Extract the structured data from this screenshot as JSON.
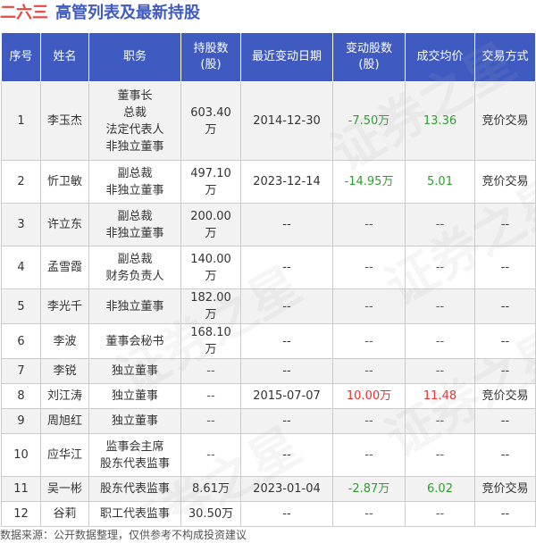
{
  "title": {
    "stock_name": "二六三",
    "rest": "高管列表及最新持股"
  },
  "columns": [
    "序号",
    "姓名",
    "职务",
    "持股数\n(股)",
    "最近变动日期",
    "变动股数\n(股)",
    "成交均价",
    "交易方式"
  ],
  "rows": [
    {
      "no": "1",
      "name": "李玉杰",
      "positions": [
        "董事长",
        "总裁",
        "法定代表人",
        "非独立董事"
      ],
      "shares": "603.40万",
      "date": "2014-12-30",
      "change": "-7.50万",
      "change_dir": "neg",
      "price": "13.36",
      "price_dir": "neg",
      "method": "竞价交易"
    },
    {
      "no": "2",
      "name": "忻卫敏",
      "positions": [
        "副总裁",
        "非独立董事"
      ],
      "shares": "497.10万",
      "date": "2023-12-14",
      "change": "-14.95万",
      "change_dir": "neg",
      "price": "5.01",
      "price_dir": "neg",
      "method": "竞价交易"
    },
    {
      "no": "3",
      "name": "许立东",
      "positions": [
        "副总裁",
        "非独立董事"
      ],
      "shares": "200.00万",
      "date": "--",
      "change": "--",
      "change_dir": "dash",
      "price": "--",
      "price_dir": "dash",
      "method": "--"
    },
    {
      "no": "4",
      "name": "孟雪霞",
      "positions": [
        "副总裁",
        "财务负责人"
      ],
      "shares": "140.00万",
      "date": "--",
      "change": "--",
      "change_dir": "dash",
      "price": "--",
      "price_dir": "dash",
      "method": "--"
    },
    {
      "no": "5",
      "name": "李光千",
      "positions": [
        "非独立董事"
      ],
      "shares": "182.00万",
      "date": "--",
      "change": "--",
      "change_dir": "dash",
      "price": "--",
      "price_dir": "dash",
      "method": "--"
    },
    {
      "no": "6",
      "name": "李波",
      "positions": [
        "董事会秘书"
      ],
      "shares": "168.10万",
      "date": "--",
      "change": "--",
      "change_dir": "dash",
      "price": "--",
      "price_dir": "dash",
      "method": "--"
    },
    {
      "no": "7",
      "name": "李锐",
      "positions": [
        "独立董事"
      ],
      "shares": "--",
      "date": "--",
      "change": "--",
      "change_dir": "dash",
      "price": "--",
      "price_dir": "dash",
      "method": "--"
    },
    {
      "no": "8",
      "name": "刘江涛",
      "positions": [
        "独立董事"
      ],
      "shares": "--",
      "date": "2015-07-07",
      "change": "10.00万",
      "change_dir": "pos",
      "price": "11.48",
      "price_dir": "pos",
      "method": "竞价交易"
    },
    {
      "no": "9",
      "name": "周旭红",
      "positions": [
        "独立董事"
      ],
      "shares": "--",
      "date": "--",
      "change": "--",
      "change_dir": "dash",
      "price": "--",
      "price_dir": "dash",
      "method": "--"
    },
    {
      "no": "10",
      "name": "应华江",
      "positions": [
        "监事会主席",
        "股东代表监事"
      ],
      "shares": "--",
      "date": "--",
      "change": "--",
      "change_dir": "dash",
      "price": "--",
      "price_dir": "dash",
      "method": "--"
    },
    {
      "no": "11",
      "name": "吴一彬",
      "positions": [
        "股东代表监事"
      ],
      "shares": "8.61万",
      "date": "2023-01-04",
      "change": "-2.87万",
      "change_dir": "neg",
      "price": "6.02",
      "price_dir": "neg",
      "method": "竞价交易"
    },
    {
      "no": "12",
      "name": "谷莉",
      "positions": [
        "职工代表监事"
      ],
      "shares": "30.50万",
      "date": "--",
      "change": "--",
      "change_dir": "dash",
      "price": "--",
      "price_dir": "dash",
      "method": "--"
    }
  ],
  "footer": "数据来源：公开数据整理，仅供参考不构成投资建议",
  "watermark": "证券之星",
  "colors": {
    "header_bg": "#3F5BC2",
    "title_stock": "#E8473B",
    "title_main": "#3F5BC2",
    "positive": "#E62F2F",
    "negative": "#2E9E2E"
  }
}
